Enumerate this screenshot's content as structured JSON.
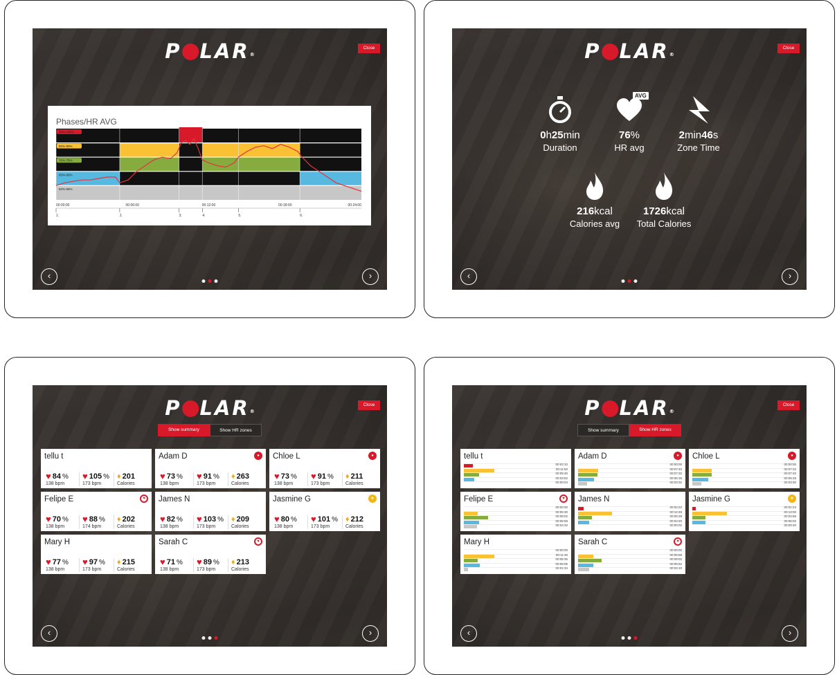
{
  "brand": {
    "letters_start": "P",
    "letters_end": "LAR",
    "reg": "®",
    "close_label": "Close",
    "prev_glyph": "‹",
    "next_glyph": "›"
  },
  "colors": {
    "accent": "#d7192a",
    "zone5": "#d7192a",
    "zone4": "#f9c133",
    "zone3": "#86ac3f",
    "zone2": "#57b8e0",
    "zone1": "#c7c7c7",
    "line": "#e4323c"
  },
  "screens": [
    {
      "id": "phases",
      "active_dot": 0
    },
    {
      "id": "summary",
      "active_dot": 1
    },
    {
      "id": "summary-cards",
      "active_dot": 2
    },
    {
      "id": "zone-cards",
      "active_dot": 2
    }
  ],
  "chart_data": {
    "type": "line",
    "title": "Phases/HR AVG",
    "xlabel": "",
    "ylabel": "",
    "zone_labels": [
      "90%-100%",
      "80%-90%",
      "70%-79%",
      "60%-69%",
      "50%-59%"
    ],
    "xlim": [
      0,
      1440
    ],
    "ylim": [
      50,
      100
    ],
    "x_ticks": [
      "00:00:00",
      "00:06:00",
      "00:12:00",
      "00:18:00",
      "00:24:00"
    ],
    "x_tick_seconds": [
      0,
      360,
      720,
      1080,
      1440
    ],
    "phase_markers": [
      {
        "label": "1.",
        "t": 0
      },
      {
        "label": "2.",
        "t": 300
      },
      {
        "label": "3.",
        "t": 580
      },
      {
        "label": "4.",
        "t": 690
      },
      {
        "label": "5.",
        "t": 860
      },
      {
        "label": "6.",
        "t": 1150
      }
    ],
    "phase_zones": [
      {
        "from": 0,
        "to": 300,
        "zone": 2
      },
      {
        "from": 300,
        "to": 580,
        "zone": 4
      },
      {
        "from": 580,
        "to": 690,
        "zone": 5
      },
      {
        "from": 690,
        "to": 860,
        "zone": 4
      },
      {
        "from": 860,
        "to": 1150,
        "zone": 4
      },
      {
        "from": 1150,
        "to": 1440,
        "zone": 2
      }
    ],
    "series": [
      {
        "x": [
          0,
          40,
          80,
          120,
          160,
          200,
          240,
          280,
          300,
          340,
          380,
          420,
          460,
          500,
          540,
          570,
          590,
          610,
          630,
          650,
          670,
          690,
          720,
          760,
          800,
          840,
          860,
          900,
          940,
          980,
          1020,
          1060,
          1100,
          1140,
          1160,
          1200,
          1240,
          1280,
          1320,
          1360,
          1400,
          1440
        ],
        "values": [
          60,
          62,
          63,
          64,
          64,
          65,
          66,
          66,
          62,
          64,
          70,
          74,
          78,
          80,
          79,
          83,
          90,
          92,
          89,
          93,
          86,
          78,
          76,
          74,
          73,
          76,
          80,
          84,
          87,
          88,
          86,
          89,
          87,
          84,
          80,
          74,
          70,
          66,
          62,
          60,
          58,
          56
        ]
      }
    ]
  },
  "summary": {
    "duration": {
      "h": "0",
      "h_unit": "h",
      "m": "25",
      "m_unit": "min",
      "label": "Duration"
    },
    "hr_avg": {
      "value": "76",
      "unit": "%",
      "label": "HR avg",
      "badge": "AVG"
    },
    "zone_time": {
      "m": "2",
      "m_unit": "min",
      "s": "46",
      "s_unit": "s",
      "label": "Zone Time"
    },
    "calories_avg": {
      "value": "216",
      "unit": "kcal",
      "label": "Calories avg"
    },
    "total_calories": {
      "value": "1726",
      "unit": "kcal",
      "label": "Total Calories"
    }
  },
  "toggle": {
    "summary_label": "Show summary",
    "zones_label": "Show HR zones"
  },
  "participants": [
    {
      "name": "tellu t",
      "badge": "",
      "hr_pct": "84",
      "hr_bpm": "138 bpm",
      "max_pct": "105",
      "max_bpm": "173 bpm",
      "cal": "201",
      "cal_label": "Calories",
      "zones": [
        {
          "z": 5,
          "w": 0.21,
          "t": "00:03:10"
        },
        {
          "z": 4,
          "w": 0.74,
          "t": "00:11:50"
        },
        {
          "z": 3,
          "w": 0.36,
          "t": "00:05:40"
        },
        {
          "z": 2,
          "w": 0.25,
          "t": "00:03:52"
        },
        {
          "z": 1,
          "w": 0.0,
          "t": "00:00:04"
        }
      ]
    },
    {
      "name": "Adam D",
      "badge": "red",
      "badge_text": "●",
      "hr_pct": "73",
      "hr_bpm": "138 bpm",
      "max_pct": "91",
      "max_bpm": "173 bpm",
      "cal": "263",
      "cal_label": "Calories",
      "zones": [
        {
          "z": 5,
          "w": 0.0,
          "t": "00:00:00"
        },
        {
          "z": 4,
          "w": 0.49,
          "t": "00:07:40"
        },
        {
          "z": 3,
          "w": 0.47,
          "t": "00:07:32"
        },
        {
          "z": 2,
          "w": 0.39,
          "t": "00:06:18"
        },
        {
          "z": 1,
          "w": 0.22,
          "t": "00:03:32"
        }
      ]
    },
    {
      "name": "Chloe L",
      "badge": "red",
      "badge_text": "●",
      "hr_pct": "73",
      "hr_bpm": "138 bpm",
      "max_pct": "91",
      "max_bpm": "173 bpm",
      "cal": "211",
      "cal_label": "Calories",
      "zones": [
        {
          "z": 5,
          "w": 0.0,
          "t": "00:00:00"
        },
        {
          "z": 4,
          "w": 0.47,
          "t": "00:07:34"
        },
        {
          "z": 3,
          "w": 0.47,
          "t": "00:07:40"
        },
        {
          "z": 2,
          "w": 0.39,
          "t": "00:06:18"
        },
        {
          "z": 1,
          "w": 0.22,
          "t": "00:03:30"
        }
      ]
    },
    {
      "name": "Felipe E",
      "badge": "white",
      "badge_text": "♥",
      "hr_pct": "70",
      "hr_bpm": "138 bpm",
      "max_pct": "88",
      "max_bpm": "174 bpm",
      "cal": "202",
      "cal_label": "Calories",
      "zones": [
        {
          "z": 5,
          "w": 0.0,
          "t": "00:00:00"
        },
        {
          "z": 4,
          "w": 0.34,
          "t": "00:05:30"
        },
        {
          "z": 3,
          "w": 0.58,
          "t": "00:09:02"
        },
        {
          "z": 2,
          "w": 0.36,
          "t": "00:05:58"
        },
        {
          "z": 1,
          "w": 0.31,
          "t": "00:04:32"
        }
      ]
    },
    {
      "name": "James N",
      "badge": "",
      "hr_pct": "82",
      "hr_bpm": "138 bpm",
      "max_pct": "103",
      "max_bpm": "173 bpm",
      "cal": "209",
      "cal_label": "Calories",
      "zones": [
        {
          "z": 5,
          "w": 0.14,
          "t": "00:02:22"
        },
        {
          "z": 4,
          "w": 0.81,
          "t": "00:12:48"
        },
        {
          "z": 3,
          "w": 0.34,
          "t": "00:05:28"
        },
        {
          "z": 2,
          "w": 0.27,
          "t": "00:04:20"
        },
        {
          "z": 1,
          "w": 0.0,
          "t": "00:00:02"
        }
      ]
    },
    {
      "name": "Jasmine G",
      "badge": "yellow",
      "badge_text": "★",
      "hr_pct": "80",
      "hr_bpm": "138 bpm",
      "max_pct": "101",
      "max_bpm": "173 bpm",
      "cal": "212",
      "cal_label": "Calories",
      "zones": [
        {
          "z": 5,
          "w": 0.08,
          "t": "00:01:24"
        },
        {
          "z": 4,
          "w": 0.83,
          "t": "00:13:00"
        },
        {
          "z": 3,
          "w": 0.32,
          "t": "00:04:56"
        },
        {
          "z": 2,
          "w": 0.32,
          "t": "00:05:02"
        },
        {
          "z": 1,
          "w": 0.0,
          "t": "00:00:40"
        }
      ]
    },
    {
      "name": "Mary H",
      "badge": "",
      "hr_pct": "77",
      "hr_bpm": "138 bpm",
      "max_pct": "97",
      "max_bpm": "173 bpm",
      "cal": "215",
      "cal_label": "Calories",
      "zones": [
        {
          "z": 5,
          "w": 0.0,
          "t": "00:00:00"
        },
        {
          "z": 4,
          "w": 0.74,
          "t": "00:11:46"
        },
        {
          "z": 3,
          "w": 0.34,
          "t": "00:05:36"
        },
        {
          "z": 2,
          "w": 0.39,
          "t": "00:06:06"
        },
        {
          "z": 1,
          "w": 0.1,
          "t": "00:01:34"
        }
      ]
    },
    {
      "name": "Sarah C",
      "badge": "white",
      "badge_text": "♥",
      "hr_pct": "71",
      "hr_bpm": "138 bpm",
      "max_pct": "89",
      "max_bpm": "173 bpm",
      "cal": "213",
      "cal_label": "Calories",
      "zones": [
        {
          "z": 5,
          "w": 0.0,
          "t": "00:00:00"
        },
        {
          "z": 4,
          "w": 0.37,
          "t": "00:05:58"
        },
        {
          "z": 3,
          "w": 0.57,
          "t": "00:09:02"
        },
        {
          "z": 2,
          "w": 0.36,
          "t": "00:05:52"
        },
        {
          "z": 1,
          "w": 0.26,
          "t": "00:04:10"
        }
      ]
    }
  ]
}
